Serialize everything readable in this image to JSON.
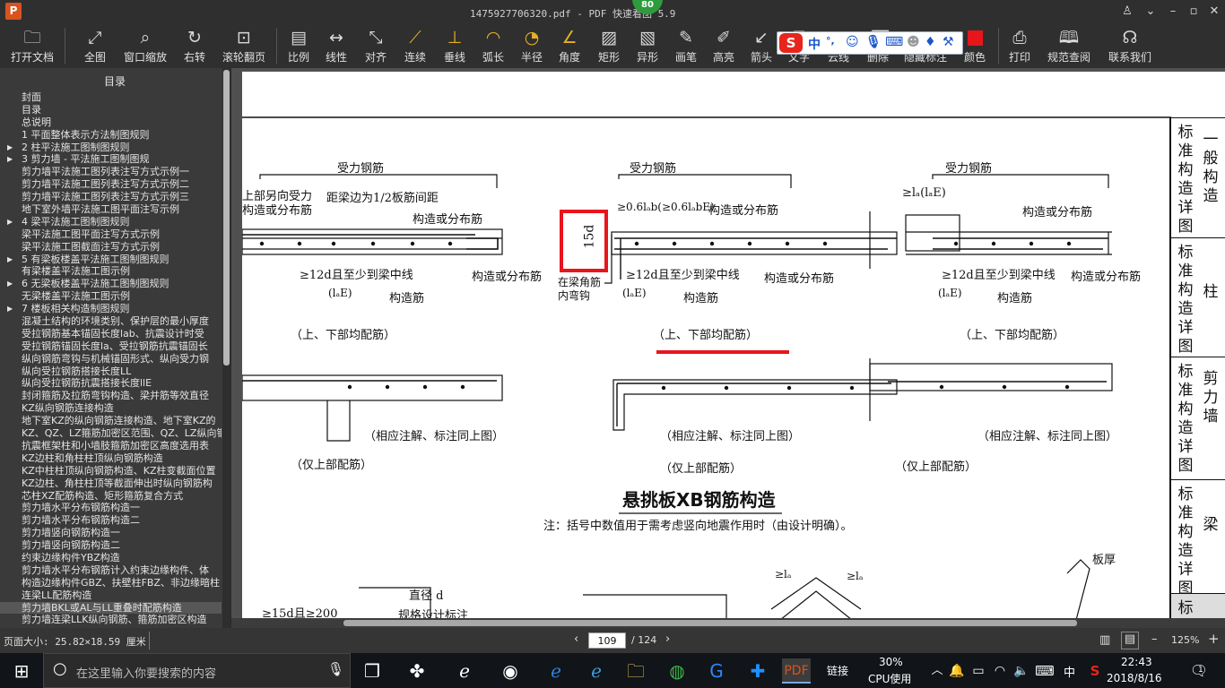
{
  "window": {
    "title": "1475927706320.pdf - PDF 快速看图 5.9",
    "badge": "80"
  },
  "toolbar": {
    "open": "打开文档",
    "fit": "全图",
    "window_zoom": "窗口缩放",
    "rotate": "右转",
    "scroll_page": "滚轮翻页",
    "scale": "比例",
    "linear": "线性",
    "align": "对齐",
    "continuous": "连续",
    "perpendicular": "垂线",
    "arc_length": "弧长",
    "radius": "半径",
    "angle": "角度",
    "rectangle": "矩形",
    "irregular": "异形",
    "pen": "画笔",
    "highlight": "高亮",
    "arrow": "箭头",
    "text": "文字",
    "cloud": "云线",
    "delete": "删除",
    "hide_mark": "隐藏标注",
    "color": "颜色",
    "print": "打印",
    "standard_query": "规范查阅",
    "contact": "联系我们"
  },
  "ime": {
    "lang": "中",
    "punct": "°,"
  },
  "sidebar": {
    "title": "目录",
    "items": [
      {
        "label": "封面",
        "arrow": ""
      },
      {
        "label": "目录",
        "arrow": ""
      },
      {
        "label": "总说明",
        "arrow": ""
      },
      {
        "label": "1 平面整体表示方法制图规则",
        "arrow": ""
      },
      {
        "label": "2 柱平法施工图制图规则",
        "arrow": "▶"
      },
      {
        "label": "3 剪力墙 - 平法施工图制图规",
        "arrow": "▶"
      },
      {
        "label": "剪力墙平法施工图列表注写方式示例一",
        "arrow": ""
      },
      {
        "label": "剪力墙平法施工图列表注写方式示例二",
        "arrow": ""
      },
      {
        "label": "剪力墙平法施工图列表注写方式示例三",
        "arrow": ""
      },
      {
        "label": "地下室外墙平法施工图平面注写示例",
        "arrow": ""
      },
      {
        "label": "4 梁平法施工图制图规则",
        "arrow": "▶"
      },
      {
        "label": "梁平法施工图平面注写方式示例",
        "arrow": ""
      },
      {
        "label": "梁平法施工图截面注写方式示例",
        "arrow": ""
      },
      {
        "label": "5 有梁板楼盖平法施工图制图规则",
        "arrow": "▶"
      },
      {
        "label": "有梁楼盖平法施工图示例",
        "arrow": ""
      },
      {
        "label": "6 无梁板楼盖平法施工图制图规则",
        "arrow": "▶"
      },
      {
        "label": "无梁楼盖平法施工图示例",
        "arrow": ""
      },
      {
        "label": "7 楼板相关构造制图规则",
        "arrow": "▶"
      },
      {
        "label": "混凝土结构的环境类别、保护层的最小厚度",
        "arrow": ""
      },
      {
        "label": "受拉钢筋基本锚固长度lab、抗震设计时受",
        "arrow": ""
      },
      {
        "label": "受拉钢筋锚固长度la、受拉钢筋抗震锚固长",
        "arrow": ""
      },
      {
        "label": "纵向钢筋弯钩与机械锚固形式、纵向受力钢",
        "arrow": ""
      },
      {
        "label": "纵向受拉钢筋搭接长度LL",
        "arrow": ""
      },
      {
        "label": "纵向受拉钢筋抗震搭接长度llE",
        "arrow": ""
      },
      {
        "label": "封闭箍筋及拉筋弯钩构造、梁并筋等效直径",
        "arrow": ""
      },
      {
        "label": "KZ纵向钢筋连接构造",
        "arrow": ""
      },
      {
        "label": "地下室KZ的纵向钢筋连接构造、地下室KZ的",
        "arrow": ""
      },
      {
        "label": "KZ、QZ、LZ箍筋加密区范围、QZ、LZ纵向钢",
        "arrow": ""
      },
      {
        "label": "抗震框架柱和小墙肢箍筋加密区高度选用表",
        "arrow": ""
      },
      {
        "label": "KZ边柱和角柱柱顶纵向钢筋构造",
        "arrow": ""
      },
      {
        "label": "KZ中柱柱顶纵向钢筋构造、KZ柱变截面位置",
        "arrow": ""
      },
      {
        "label": "KZ边柱、角柱柱顶等截面伸出时纵向钢筋构",
        "arrow": ""
      },
      {
        "label": "芯柱XZ配筋构造、矩形箍筋复合方式",
        "arrow": ""
      },
      {
        "label": "剪力墙水平分布钢筋构造一",
        "arrow": ""
      },
      {
        "label": "剪力墙水平分布钢筋构造二",
        "arrow": ""
      },
      {
        "label": "剪力墙竖向钢筋构造一",
        "arrow": ""
      },
      {
        "label": "剪力墙竖向钢筋构造二",
        "arrow": ""
      },
      {
        "label": "约束边缘构件YBZ构造",
        "arrow": ""
      },
      {
        "label": "剪力墙水平分布钢筋计入约束边缘构件、体",
        "arrow": ""
      },
      {
        "label": "构造边缘构件GBZ、扶壁柱FBZ、非边缘暗柱",
        "arrow": ""
      },
      {
        "label": "连梁LL配筋构造",
        "arrow": ""
      },
      {
        "label": "剪力墙BKL或AL与LL重叠时配筋构造",
        "arrow": ""
      },
      {
        "label": "剪力墙连梁LLK纵向钢筋、箍筋加密区构造",
        "arrow": ""
      }
    ]
  },
  "drawing": {
    "title": "悬挑板XB钢筋构造",
    "note": "注：括号中数值用于需考虑竖向地震作用时（由设计明确）。",
    "stressed_bar": "受力钢筋",
    "structural_bar": "构造或分布筋",
    "structural": "构造筋",
    "top_bottom": "（上、下部均配筋）",
    "top_only": "（仅上部配筋）",
    "same_as_above": "（相应注解、标注同上图）",
    "half_spacing": "距梁边为1/2板筋间距",
    "top_opposite": "上部另向受力",
    "structural_or": "构造或分布筋",
    "ge_12d": "≥12d且至少到梁中线",
    "lab_label": "(lₐE)",
    "anchor_06": "≥0.6lₐb(≥0.6lₐbE)",
    "anchor_la": "≥lₐ(lₐE)",
    "d15": "15d",
    "inner_hook": "在梁角筋内弯钩",
    "diameter": "直径 d",
    "spec": "规格设计标注",
    "ge_15d": "≥15d且≥200",
    "slab_thick": "板厚",
    "la": "≥lₐ",
    "side_tabs": [
      {
        "a": "标准构造详图",
        "b": "一般构造"
      },
      {
        "a": "标准构造详图",
        "b": "柱"
      },
      {
        "a": "标准构造详图",
        "b": "剪力墙"
      },
      {
        "a": "标准构造详图",
        "b": "梁"
      },
      {
        "a": "标准",
        "b": ""
      }
    ]
  },
  "status": {
    "page_size": "页面大小: 25.82×18.59 厘米",
    "page_current": "109",
    "page_total": "/ 124",
    "zoom": "125%"
  },
  "taskbar": {
    "search_placeholder": "在这里输入你要搜索的内容",
    "link_label": "链接",
    "cpu_percent": "30%",
    "cpu_label": "CPU使用",
    "ime_lang": "中",
    "time": "22:43",
    "date": "2018/8/16",
    "notif_count": "1"
  },
  "colors": {
    "annotation_red": "#e8151b",
    "app_dark": "#2f2f2f",
    "logo_orange": "#d9531e"
  }
}
